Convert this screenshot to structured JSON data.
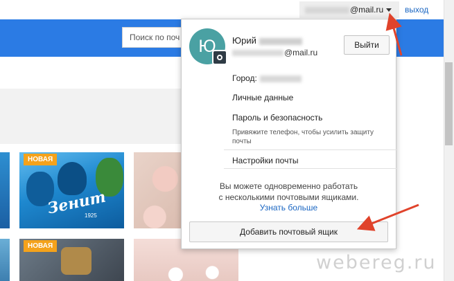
{
  "header": {
    "account_email_suffix": "@mail.ru",
    "logout_label": "выход",
    "search_placeholder": "Поиск по поч"
  },
  "dropdown": {
    "avatar_letter": "Ю",
    "user_first_name": "Юрий",
    "user_email_suffix": "@mail.ru",
    "signout_label": "Выйти",
    "city_label": "Город:",
    "personal_data_label": "Личные данные",
    "password_security_label": "Пароль и безопасность",
    "phone_hint": "Привяжите телефон, чтобы усилить защиту почты",
    "mail_settings_label": "Настройки почты",
    "multi_mailbox_line1": "Вы можете одновременно работать",
    "multi_mailbox_line2": "с несколькими почтовыми ящиками.",
    "learn_more_label": "Узнать больше",
    "add_mailbox_label": "Добавить почтовый ящик"
  },
  "tiles": {
    "badge_new": "НОВАЯ",
    "zenit_logo": "Зенит",
    "zenit_year": "1925"
  },
  "watermark": "webereg.ru",
  "colors": {
    "header_blue": "#2b7be4",
    "link_blue": "#1a66c2",
    "badge_orange": "#f4a21b",
    "arrow_red": "#e0432b",
    "avatar_teal": "#4aa1a3"
  },
  "icons": [
    "caret-down-icon",
    "camera-icon"
  ]
}
